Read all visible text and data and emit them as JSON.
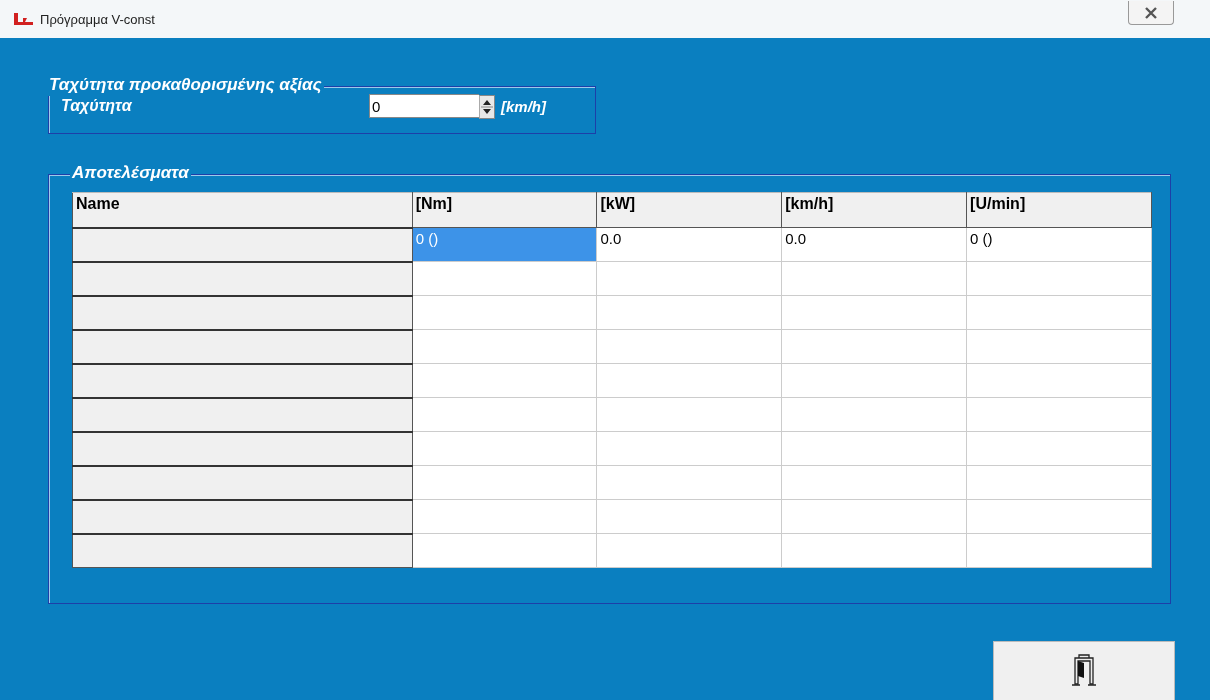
{
  "window": {
    "title": "Πρόγραμμα V-const"
  },
  "speed_group": {
    "title": "Ταχύτητα προκαθορισμένης αξίας",
    "label": "Ταχύτητα",
    "value": "0",
    "unit": "[km/h]"
  },
  "results_group": {
    "title": "Αποτελέσματα"
  },
  "table": {
    "columns": [
      "Name",
      "[Nm]",
      "[kW]",
      "[km/h]",
      "[U/min]"
    ],
    "rows": [
      {
        "cells": [
          {
            "text": "0 ()",
            "selected": true
          },
          {
            "text": "0.0",
            "selected": false
          },
          {
            "text": "0.0",
            "selected": false
          },
          {
            "text": "0 ()",
            "selected": false
          }
        ]
      },
      {},
      {},
      {},
      {},
      {},
      {},
      {},
      {},
      {}
    ]
  }
}
